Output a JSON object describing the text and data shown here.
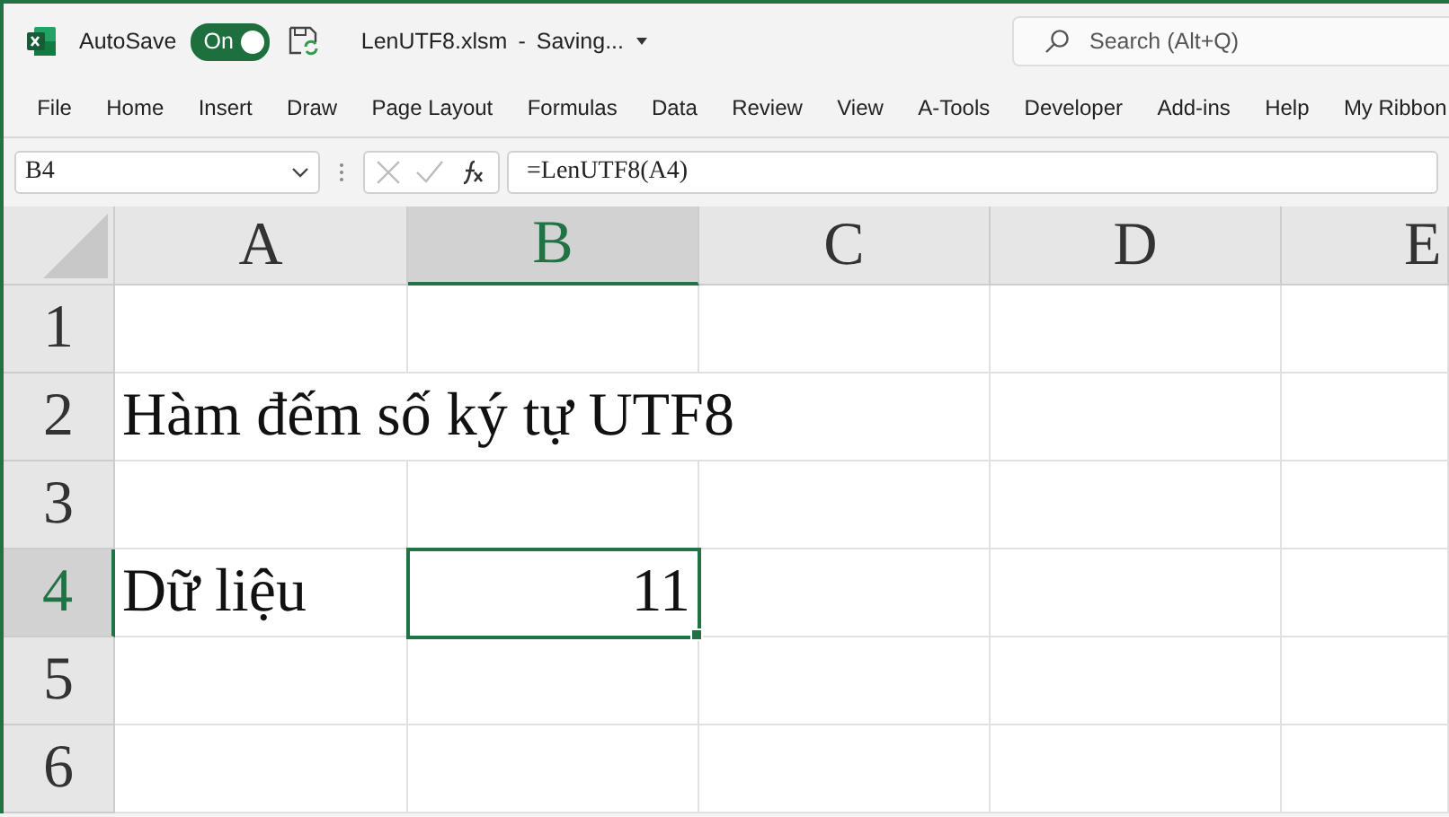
{
  "title_bar": {
    "autosave_label": "AutoSave",
    "autosave": {
      "on": true,
      "label": "On"
    },
    "file_name": "LenUTF8.xlsm",
    "separator": "-",
    "status": "Saving...",
    "search": {
      "placeholder": "Search (Alt+Q)"
    }
  },
  "menu": [
    {
      "label": "File"
    },
    {
      "label": "Home"
    },
    {
      "label": "Insert"
    },
    {
      "label": "Draw"
    },
    {
      "label": "Page Layout"
    },
    {
      "label": "Formulas"
    },
    {
      "label": "Data"
    },
    {
      "label": "Review"
    },
    {
      "label": "View"
    },
    {
      "label": "A-Tools"
    },
    {
      "label": "Developer"
    },
    {
      "label": "Add-ins"
    },
    {
      "label": "Help"
    },
    {
      "label": "My Ribbon"
    }
  ],
  "formula_bar": {
    "name_box": "B4",
    "formula": "=LenUTF8(A4)"
  },
  "sheet": {
    "columns": [
      {
        "label": "A",
        "selected": false
      },
      {
        "label": "B",
        "selected": true
      },
      {
        "label": "C",
        "selected": false
      },
      {
        "label": "D",
        "selected": false
      },
      {
        "label": "E",
        "selected": false
      }
    ],
    "rows": [
      {
        "label": "1",
        "selected": false,
        "cells": [
          {
            "selected": false
          },
          {
            "selected": false
          },
          {
            "selected": false
          },
          {
            "selected": false
          },
          {
            "selected": false
          }
        ]
      },
      {
        "label": "2",
        "selected": false,
        "cells": [
          {
            "kind": "text",
            "text": "Hàm đếm số ký tự UTF8",
            "selected": false
          },
          {
            "selected": false
          },
          {
            "selected": false
          },
          {
            "selected": false
          },
          {
            "selected": false
          }
        ]
      },
      {
        "label": "3",
        "selected": false,
        "cells": [
          {
            "selected": false
          },
          {
            "selected": false
          },
          {
            "selected": false
          },
          {
            "selected": false
          },
          {
            "selected": false
          }
        ]
      },
      {
        "label": "4",
        "selected": true,
        "cells": [
          {
            "kind": "text",
            "text": "Dữ liệu",
            "selected": false
          },
          {
            "kind": "number",
            "text": "11",
            "selected": true
          },
          {
            "selected": false
          },
          {
            "selected": false
          },
          {
            "selected": false
          }
        ]
      },
      {
        "label": "5",
        "selected": false,
        "cells": [
          {
            "selected": false
          },
          {
            "selected": false
          },
          {
            "selected": false
          },
          {
            "selected": false
          },
          {
            "selected": false
          }
        ]
      },
      {
        "label": "6",
        "selected": false,
        "cells": [
          {
            "selected": false
          },
          {
            "selected": false
          },
          {
            "selected": false
          },
          {
            "selected": false
          },
          {
            "selected": false
          }
        ]
      }
    ]
  }
}
